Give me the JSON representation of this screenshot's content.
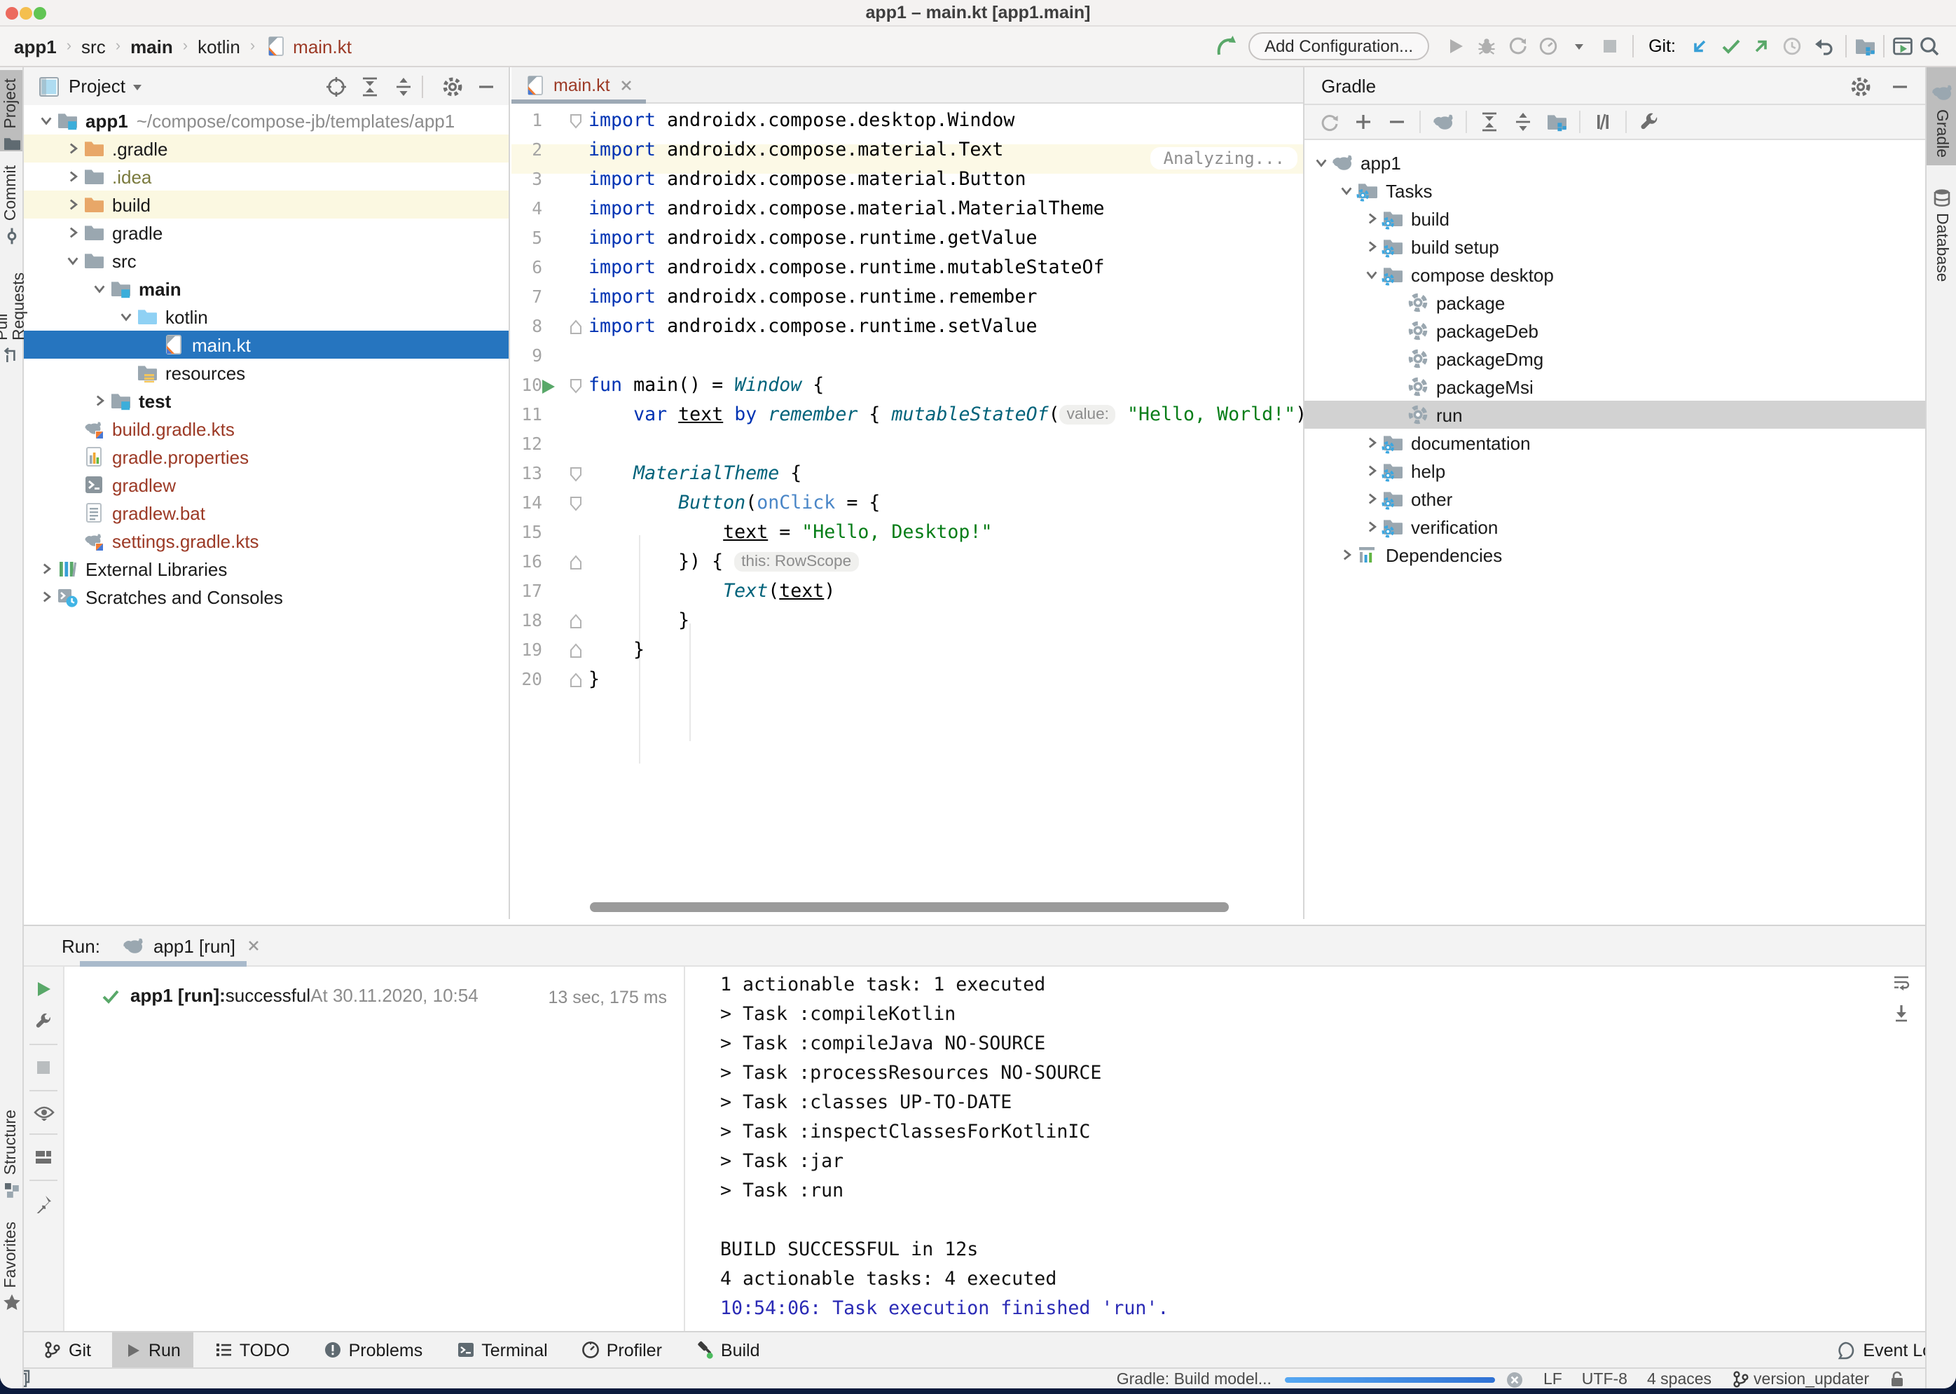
{
  "window": {
    "title": "app1 – main.kt [app1.main]"
  },
  "navbar": {
    "breadcrumbs": [
      {
        "label": "app1",
        "bold": true
      },
      {
        "label": "src"
      },
      {
        "label": "main",
        "bold": true
      },
      {
        "label": "kotlin"
      },
      {
        "label": "main.kt",
        "icon": "kotlin-file",
        "color": "#9C3A26"
      }
    ],
    "add_configuration": "Add Configuration...",
    "git_label": "Git:"
  },
  "left_strip": {
    "top": [
      {
        "label": "Project",
        "icon": "tool-project",
        "active": true
      },
      {
        "label": "Commit",
        "icon": "tool-commit"
      },
      {
        "label": "Pull Requests",
        "icon": "tool-pullrequests"
      }
    ],
    "bottom": [
      {
        "label": "Structure",
        "icon": "tool-structure"
      },
      {
        "label": "Favorites",
        "icon": "tool-favorites"
      }
    ]
  },
  "right_strip": [
    {
      "label": "Gradle",
      "icon": "gradle-elephant",
      "active": true
    },
    {
      "label": "Database",
      "icon": "database"
    }
  ],
  "project_panel": {
    "title": "Project",
    "tree": [
      {
        "level": 0,
        "chevron": "down",
        "icon": "folder-src",
        "label": "app1",
        "bold": true,
        "suffix": "~/compose/compose-jb/templates/app1"
      },
      {
        "level": 1,
        "chevron": "right",
        "icon": "folder-orange",
        "label": ".gradle",
        "bg": "#FBF8E1"
      },
      {
        "level": 1,
        "chevron": "right",
        "icon": "folder-gray",
        "label": ".idea",
        "color": "#7A7A3D"
      },
      {
        "level": 1,
        "chevron": "right",
        "icon": "folder-orange",
        "label": "build",
        "bg": "#FBF8E1"
      },
      {
        "level": 1,
        "chevron": "right",
        "icon": "folder-gray",
        "label": "gradle"
      },
      {
        "level": 1,
        "chevron": "down",
        "icon": "folder-gray",
        "label": "src"
      },
      {
        "level": 2,
        "chevron": "down",
        "icon": "folder-src",
        "label": "main",
        "bold": true
      },
      {
        "level": 3,
        "chevron": "down",
        "icon": "folder-kotlin",
        "label": "kotlin"
      },
      {
        "level": 4,
        "chevron": null,
        "icon": "kotlin-file",
        "label": "main.kt",
        "selected": true
      },
      {
        "level": 3,
        "chevron": null,
        "icon": "folder-resources",
        "label": "resources"
      },
      {
        "level": 2,
        "chevron": "right",
        "icon": "folder-src",
        "label": "test",
        "bold": true
      },
      {
        "level": 1,
        "chevron": null,
        "icon": "gradle-kts-file",
        "label": "build.gradle.kts",
        "color": "#9C3A26"
      },
      {
        "level": 1,
        "chevron": null,
        "icon": "properties-file",
        "label": "gradle.properties",
        "color": "#9C3A26"
      },
      {
        "level": 1,
        "chevron": null,
        "icon": "shell-file",
        "label": "gradlew",
        "color": "#9C3A26"
      },
      {
        "level": 1,
        "chevron": null,
        "icon": "text-file",
        "label": "gradlew.bat",
        "color": "#9C3A26"
      },
      {
        "level": 1,
        "chevron": null,
        "icon": "gradle-kts-file",
        "label": "settings.gradle.kts",
        "color": "#9C3A26"
      },
      {
        "level": 0,
        "chevron": "right",
        "icon": "library",
        "label": "External Libraries"
      },
      {
        "level": 0,
        "chevron": "right",
        "icon": "scratches",
        "label": "Scratches and Consoles"
      }
    ]
  },
  "editor": {
    "tab": "main.kt",
    "analyzing": "Analyzing...",
    "lines": [
      {
        "n": 1,
        "fold": "down",
        "tokens": [
          [
            "kw",
            "import"
          ],
          [
            "pl",
            " androidx.compose.desktop.Window"
          ]
        ]
      },
      {
        "n": 2,
        "tokens": [
          [
            "kw",
            "import"
          ],
          [
            "pl",
            " androidx.compose.material.Text"
          ]
        ]
      },
      {
        "n": 3,
        "tokens": [
          [
            "kw",
            "import"
          ],
          [
            "pl",
            " androidx.compose.material.Button"
          ]
        ]
      },
      {
        "n": 4,
        "tokens": [
          [
            "kw",
            "import"
          ],
          [
            "pl",
            " androidx.compose.material.MaterialTheme"
          ]
        ]
      },
      {
        "n": 5,
        "tokens": [
          [
            "kw",
            "import"
          ],
          [
            "pl",
            " androidx.compose.runtime.getValue"
          ]
        ]
      },
      {
        "n": 6,
        "tokens": [
          [
            "kw",
            "import"
          ],
          [
            "pl",
            " androidx.compose.runtime.mutableStateOf"
          ]
        ]
      },
      {
        "n": 7,
        "tokens": [
          [
            "kw",
            "import"
          ],
          [
            "pl",
            " androidx.compose.runtime.remember"
          ]
        ]
      },
      {
        "n": 8,
        "fold": "up",
        "tokens": [
          [
            "kw",
            "import"
          ],
          [
            "pl",
            " androidx.compose.runtime.setValue"
          ]
        ]
      },
      {
        "n": 9,
        "tokens": []
      },
      {
        "n": 10,
        "play": true,
        "fold": "down",
        "tokens": [
          [
            "kw",
            "fun"
          ],
          [
            "pl",
            " main() = "
          ],
          [
            "fn",
            "Window"
          ],
          [
            "pl",
            " {"
          ]
        ]
      },
      {
        "n": 11,
        "tokens": [
          [
            "pl",
            "    "
          ],
          [
            "kw",
            "var"
          ],
          [
            "pl",
            " "
          ],
          [
            "und",
            "text"
          ],
          [
            "pl",
            " "
          ],
          [
            "kw",
            "by"
          ],
          [
            "pl",
            " "
          ],
          [
            "fn",
            "remember"
          ],
          [
            "pl",
            " { "
          ],
          [
            "fn",
            "mutableStateOf"
          ],
          [
            "pl",
            "("
          ],
          [
            "hint",
            "value:"
          ],
          [
            "str",
            " \"Hello, World!\""
          ],
          [
            "pl",
            ")"
          ]
        ]
      },
      {
        "n": 12,
        "tokens": []
      },
      {
        "n": 13,
        "fold": "down",
        "tokens": [
          [
            "pl",
            "    "
          ],
          [
            "fn",
            "MaterialTheme"
          ],
          [
            "pl",
            " {"
          ]
        ]
      },
      {
        "n": 14,
        "fold": "down",
        "tokens": [
          [
            "pl",
            "        "
          ],
          [
            "fn",
            "Button"
          ],
          [
            "pl",
            "("
          ],
          [
            "param",
            "onClick"
          ],
          [
            "pl",
            " = {"
          ]
        ]
      },
      {
        "n": 15,
        "tokens": [
          [
            "pl",
            "            "
          ],
          [
            "und",
            "text"
          ],
          [
            "pl",
            " = "
          ],
          [
            "str",
            "\"Hello, Desktop!\""
          ]
        ]
      },
      {
        "n": 16,
        "fold": "up",
        "tokens": [
          [
            "pl",
            "        }) { "
          ],
          [
            "hint",
            "this: RowScope"
          ]
        ]
      },
      {
        "n": 17,
        "tokens": [
          [
            "pl",
            "            "
          ],
          [
            "fn",
            "Text"
          ],
          [
            "pl",
            "("
          ],
          [
            "und",
            "text"
          ],
          [
            "pl",
            ")"
          ]
        ]
      },
      {
        "n": 18,
        "fold": "up",
        "tokens": [
          [
            "pl",
            "        }"
          ]
        ]
      },
      {
        "n": 19,
        "fold": "up",
        "tokens": [
          [
            "pl",
            "    }"
          ]
        ]
      },
      {
        "n": 20,
        "fold": "up",
        "tokens": [
          [
            "pl",
            "}"
          ]
        ]
      }
    ]
  },
  "gradle_panel": {
    "title": "Gradle",
    "tree": [
      {
        "level": 0,
        "chevron": "down",
        "icon": "gradle-elephant",
        "label": "app1"
      },
      {
        "level": 1,
        "chevron": "down",
        "icon": "folder-gear",
        "label": "Tasks"
      },
      {
        "level": 2,
        "chevron": "right",
        "icon": "folder-gear",
        "label": "build"
      },
      {
        "level": 2,
        "chevron": "right",
        "icon": "folder-gear",
        "label": "build setup"
      },
      {
        "level": 2,
        "chevron": "down",
        "icon": "folder-gear",
        "label": "compose desktop"
      },
      {
        "level": 3,
        "chevron": null,
        "icon": "task-gear",
        "label": "package"
      },
      {
        "level": 3,
        "chevron": null,
        "icon": "task-gear",
        "label": "packageDeb"
      },
      {
        "level": 3,
        "chevron": null,
        "icon": "task-gear",
        "label": "packageDmg"
      },
      {
        "level": 3,
        "chevron": null,
        "icon": "task-gear",
        "label": "packageMsi"
      },
      {
        "level": 3,
        "chevron": null,
        "icon": "task-gear",
        "label": "run",
        "selected": true
      },
      {
        "level": 2,
        "chevron": "right",
        "icon": "folder-gear",
        "label": "documentation"
      },
      {
        "level": 2,
        "chevron": "right",
        "icon": "folder-gear",
        "label": "help"
      },
      {
        "level": 2,
        "chevron": "right",
        "icon": "folder-gear",
        "label": "other"
      },
      {
        "level": 2,
        "chevron": "right",
        "icon": "folder-gear",
        "label": "verification"
      },
      {
        "level": 1,
        "chevron": "right",
        "icon": "dependencies",
        "label": "Dependencies"
      }
    ]
  },
  "run_panel": {
    "label": "Run:",
    "tab": "app1 [run]",
    "status": {
      "name": "app1 [run]:",
      "result": " successful",
      "time": " At 30.11.2020, 10:54",
      "duration": "13 sec, 175 ms"
    },
    "console": [
      {
        "t": "1 actionable task: 1 executed"
      },
      {
        "t": "> Task :compileKotlin"
      },
      {
        "t": "> Task :compileJava NO-SOURCE"
      },
      {
        "t": "> Task :processResources NO-SOURCE"
      },
      {
        "t": "> Task :classes UP-TO-DATE"
      },
      {
        "t": "> Task :inspectClassesForKotlinIC"
      },
      {
        "t": "> Task :jar"
      },
      {
        "t": "> Task :run"
      },
      {
        "t": ""
      },
      {
        "t": "BUILD SUCCESSFUL in 12s"
      },
      {
        "t": "4 actionable tasks: 4 executed"
      },
      {
        "t": "10:54:06: Task execution finished 'run'.",
        "color": "blue"
      }
    ]
  },
  "bottom_bar": {
    "items": [
      {
        "label": "Git",
        "icon": "git-branch"
      },
      {
        "label": "Run",
        "icon": "play-small",
        "active": true
      },
      {
        "label": "TODO",
        "icon": "todo-list"
      },
      {
        "label": "Problems",
        "icon": "problems"
      },
      {
        "label": "Terminal",
        "icon": "terminal"
      },
      {
        "label": "Profiler",
        "icon": "profiler"
      },
      {
        "label": "Build",
        "icon": "build-hammer"
      }
    ],
    "event_log": "Event Log"
  },
  "status_bar": {
    "progress_label": "Gradle: Build model...",
    "line_ending": "LF",
    "encoding": "UTF-8",
    "indent": "4 spaces",
    "branch": "version_updater"
  }
}
